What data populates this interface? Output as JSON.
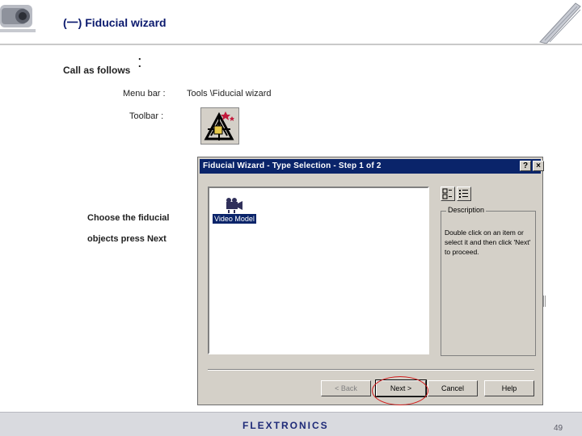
{
  "header": {
    "title": "(一)  Fiducial wizard"
  },
  "content": {
    "call_label": "Call as follows",
    "call_colon": ":",
    "menu_label": "Menu bar :",
    "menu_path": "Tools \\Fiducial wizard",
    "toolbar_label": "Toolbar :",
    "instruction_line1": "Choose the fiducial",
    "instruction_line2": "objects press Next"
  },
  "dialog": {
    "title": "Fiducial Wizard - Type Selection - Step 1 of 2",
    "help_glyph": "?",
    "close_glyph": "×",
    "list_items": [
      {
        "label": "Video Model",
        "icon": "video-camera-icon",
        "selected": true
      }
    ],
    "description": {
      "legend": "Description",
      "text": "Double click on an item or select it and then click 'Next' to proceed."
    },
    "buttons": {
      "back": "< Back",
      "next": "Next >",
      "cancel": "Cancel",
      "help": "Help"
    }
  },
  "footer": {
    "brand": "FLEXTRONICS",
    "page_number": "49"
  },
  "colors": {
    "title_blue": "#0b1a6e",
    "titlebar": "#0a246a",
    "dialog_face": "#d4d0c8",
    "highlight_circle": "#d21b1b",
    "footer_bg": "#d9dadf"
  }
}
